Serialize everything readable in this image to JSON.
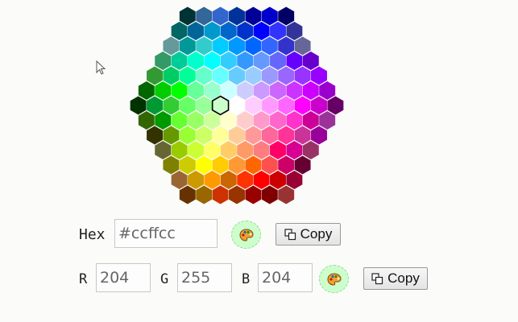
{
  "colors": {
    "selected": "#ccffcc",
    "swatch_bg": "#ccffcc",
    "hex_outline_selected": "#000000"
  },
  "hex_palette_rows": [
    [
      "#003333",
      "#336699",
      "#3366cc",
      "#003399",
      "#000099",
      "#0000cc",
      "#000066"
    ],
    [
      "#006666",
      "#006699",
      "#0099cc",
      "#0066cc",
      "#0033cc",
      "#0000ff",
      "#3333ff",
      "#333399"
    ],
    [
      "#669999",
      "#009999",
      "#33cccc",
      "#00ccff",
      "#0099ff",
      "#0066ff",
      "#3366ff",
      "#3333cc",
      "#666699"
    ],
    [
      "#339966",
      "#00cc99",
      "#00ffcc",
      "#00ffff",
      "#33ccff",
      "#3399ff",
      "#6699ff",
      "#6666ff",
      "#6600ff",
      "#6600cc"
    ],
    [
      "#339933",
      "#00cc66",
      "#00ff99",
      "#66ffcc",
      "#66ffff",
      "#66ccff",
      "#99ccff",
      "#9999ff",
      "#9966ff",
      "#9933ff",
      "#9900ff"
    ],
    [
      "#006600",
      "#00cc00",
      "#00ff00",
      "#66ff99",
      "#99ffcc",
      "#ccffff",
      "#ccccff",
      "#cc99ff",
      "#cc66ff",
      "#cc33ff",
      "#cc00ff",
      "#9900cc"
    ],
    [
      "#003300",
      "#009933",
      "#33cc33",
      "#66ff66",
      "#99ff99",
      "#ccffcc",
      "#ffffff",
      "#ffccff",
      "#ff99ff",
      "#ff66ff",
      "#ff00ff",
      "#cc00cc",
      "#660066"
    ],
    [
      "#336600",
      "#009900",
      "#66ff33",
      "#99ff66",
      "#ccff99",
      "#ffffcc",
      "#ffcccc",
      "#ff99cc",
      "#ff66cc",
      "#ff33cc",
      "#cc0099",
      "#993399"
    ],
    [
      "#333300",
      "#669900",
      "#99ff33",
      "#ccff66",
      "#ffff99",
      "#ffcc99",
      "#ff9999",
      "#ff6699",
      "#ff3399",
      "#cc3399",
      "#990099"
    ],
    [
      "#666633",
      "#99cc00",
      "#ccff33",
      "#ffff66",
      "#ffcc66",
      "#ff9966",
      "#ff7c80",
      "#ff0066",
      "#d60093",
      "#993366"
    ],
    [
      "#808000",
      "#cccc00",
      "#ffff00",
      "#ffcc00",
      "#ff9933",
      "#ff6600",
      "#ff5050",
      "#cc0066",
      "#660033"
    ],
    [
      "#996633",
      "#cc9900",
      "#ff9900",
      "#cc6600",
      "#ff3300",
      "#ff0000",
      "#cc0000",
      "#990033"
    ],
    [
      "#663300",
      "#996600",
      "#cc3300",
      "#993300",
      "#990000",
      "#800000",
      "#993333"
    ]
  ],
  "form": {
    "hex_label": "Hex",
    "hex_value": "#ccffcc",
    "r_label": "R",
    "r_value": "204",
    "g_label": "G",
    "g_value": "255",
    "b_label": "B",
    "b_value": "204",
    "copy_label": "Copy"
  },
  "icons": {
    "swatch_icon": "palette-icon",
    "copy_icon": "copy-icon",
    "cursor_icon": "mouse-pointer-icon"
  }
}
